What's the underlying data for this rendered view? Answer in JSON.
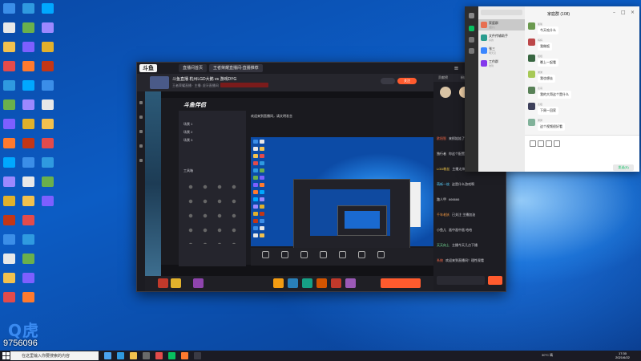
{
  "desktop": {
    "id_number": "9756096",
    "id_logo_text": "Q虎"
  },
  "main_window": {
    "logo": "斗鱼",
    "tabs": [
      "直播间首页",
      "王者荣耀直播间-直播推荐"
    ],
    "room": {
      "title": "斗鱼直播 杭州LGD大鹅 vs 游戏DYG",
      "meta": "王者荣耀直播 · 主播: 虎牙直播间",
      "follow_label": "关注"
    },
    "side_tabs": [
      "贡献榜",
      "粉丝榜",
      "礼物榜"
    ],
    "chat_messages": [
      {
        "user": "欧阳智",
        "text": "来抓娃娃了 666 今天好热",
        "color": "#ff6b4a"
      },
      {
        "user": "独行者",
        "text": "你这个配置有点高",
        "color": "#e0e0e0"
      },
      {
        "user": "LGD粉丝",
        "text": "主播太帅了！ 冲冲冲",
        "color": "#ffd24a"
      },
      {
        "user": "萌新一枚",
        "text": "这是什么游戏啊",
        "color": "#5ad1ff"
      },
      {
        "user": "路人甲",
        "text": "666666",
        "color": "#e0e0e0"
      },
      {
        "user": "千年老妖",
        "text": "已关注 主播加油",
        "color": "#ff9f43"
      },
      {
        "user": "小鱼儿",
        "text": "画中画中画 哈哈",
        "color": "#e0e0e0"
      },
      {
        "user": "天天向上",
        "text": "主播今天几点下播",
        "color": "#7bed9f"
      },
      {
        "user": "系统",
        "text": "欢迎来到直播间！理性观看",
        "color": "#ff6b4a"
      }
    ]
  },
  "inner_stream": {
    "logo": "斗鱼伴侣",
    "header_text": "欢迎来到直播间，请文明发言",
    "sidebar_items": [
      "场景 1",
      "场景 2",
      "场景 3"
    ],
    "section_label": "工具箱"
  },
  "wechat": {
    "chat_title": "家庭群 (108)",
    "contacts": [
      {
        "name": "家庭群",
        "preview": "[图片]",
        "color": "#e76f51"
      },
      {
        "name": "文件传输助手",
        "preview": "好的",
        "color": "#2a9d8f"
      },
      {
        "name": "张三",
        "preview": "明天见",
        "color": "#3a86ff"
      },
      {
        "name": "工作群",
        "preview": "收到",
        "color": "#8338ec"
      }
    ],
    "messages": [
      {
        "name": "爸爸",
        "text": "今天吃什么",
        "color": "#6a994e"
      },
      {
        "name": "妈妈",
        "text": "我做饭",
        "color": "#bc4749"
      },
      {
        "name": "姐姐",
        "text": "晚上一起看",
        "color": "#386641"
      },
      {
        "name": "弟弟",
        "text": "我也想去",
        "color": "#a7c957"
      },
      {
        "name": "表哥",
        "text": "我的大哥这个是什么",
        "color": "#588157"
      },
      {
        "name": "表姐",
        "text": "下周一回家",
        "color": "#3d405b"
      },
      {
        "name": "舅舅",
        "text": "这个视频很好看",
        "color": "#81b29a"
      }
    ],
    "send_label": "发送(S)"
  },
  "taskbar": {
    "search_placeholder": "在这里输入你要搜索的内容",
    "weather": "30°C 晴",
    "time": "17:30",
    "date": "2021/6/22"
  }
}
